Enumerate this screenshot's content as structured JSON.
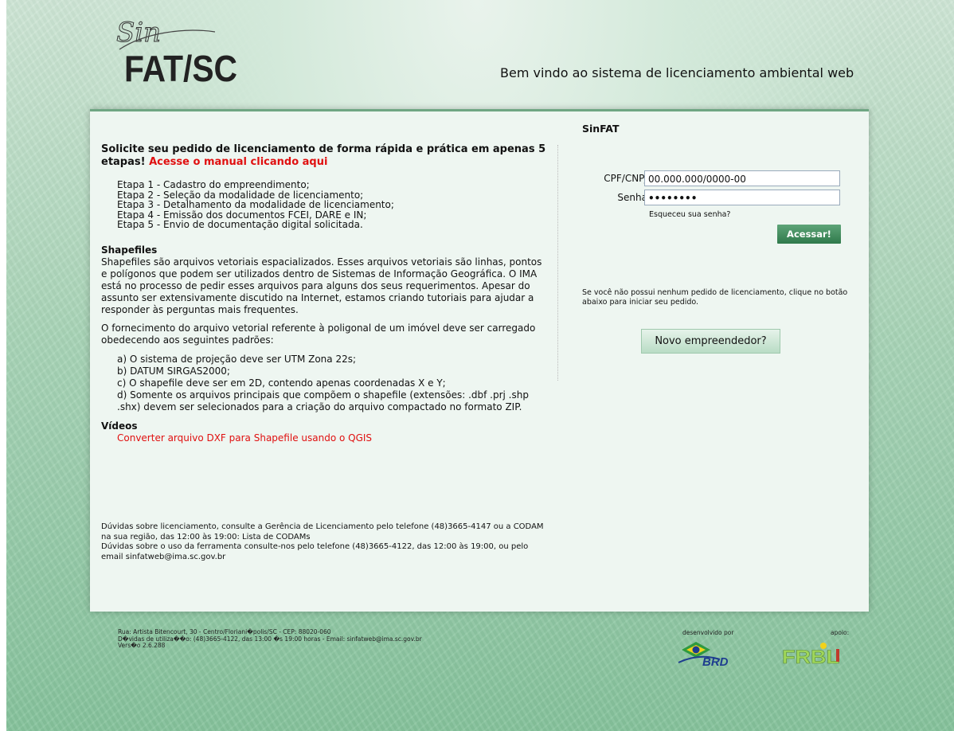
{
  "header": {
    "logo_script_text": "Sin",
    "logo_text": "FAT/SC",
    "welcome": "Bem vindo ao sistema de licenciamento ambiental web"
  },
  "intro": {
    "text": "Solicite seu pedido de licenciamento de forma rápida e prática em apenas 5 etapas!",
    "manual_link": "Acesse o manual clicando aqui"
  },
  "steps": [
    "Etapa 1 - Cadastro do empreendimento;",
    "Etapa 2 - Seleção da modalidade de licenciamento;",
    "Etapa 3 - Detalhamento da modalidade de licenciamento;",
    "Etapa 4 - Emissão dos documentos FCEI, DARE e IN;",
    "Etapa 5 - Envio de documentação digital solicitada."
  ],
  "shapefiles": {
    "heading": "Shapefiles",
    "para1": "Shapefiles são arquivos vetoriais espacializados. Esses arquivos vetoriais são linhas, pontos e polígonos que podem ser utilizados dentro de Sistemas de Informação Geográfica. O IMA está no processo de pedir esses arquivos para alguns dos seus requerimentos. Apesar do assunto ser extensivamente discutido na Internet, estamos criando tutoriais para ajudar a responder às perguntas mais frequentes.",
    "para2": "O fornecimento do arquivo vetorial referente à poligonal de um imóvel deve ser carregado obedecendo aos seguintes padrões:",
    "rules": [
      "a) O sistema de projeção deve ser UTM Zona 22s;",
      "b) DATUM SIRGAS2000;",
      "c) O shapefile deve ser em 2D, contendo apenas coordenadas X e Y;",
      "d) Somente os arquivos principais que compõem o shapefile (extensões: .dbf .prj .shp .shx) devem ser selecionados para a criação do arquivo compactado no formato ZIP."
    ]
  },
  "videos": {
    "heading": "Vídeos",
    "link": "Converter arquivo DXF para Shapefile usando o QGIS"
  },
  "contact": {
    "line1": "Dúvidas sobre licenciamento, consulte a Gerência de Licenciamento pelo telefone (48)3665-4147 ou a CODAM na sua região, das 12:00 às 19:00: Lista de CODAMs",
    "line2": "Dúvidas sobre o uso da ferramenta consulte-nos pelo telefone (48)3665-4122, das 12:00 às 19:00, ou pelo email sinfatweb@ima.sc.gov.br"
  },
  "login": {
    "title": "SinFAT",
    "cpf_label": "CPF/CNPJ:",
    "cpf_value": "00.000.000/0000-00",
    "password_label": "Senha:",
    "password_value": "••••••••",
    "forgot": "Esqueceu sua senha?",
    "submit": "Acessar!",
    "new_message": "Se você não possui nenhum pedido de licenciamento, clique no botão abaixo para iniciar seu pedido.",
    "new_button": "Novo empreendedor?"
  },
  "footer": {
    "address": "Rua: Artista Bitencourt, 30 - Centro/Floriani�polis/SC - CEP: 88020-060",
    "doubts": "D�vidas de utiliza��o: (48)3665-4122, das 13:00 �s 19:00 horas - Email: sinfatweb@ima.sc.gov.br",
    "version": "Vers�o 2.6.288",
    "developed_by": "desenvolvido por",
    "support": "apoio:",
    "brd_logo_text": "BRD",
    "frbl_logo_text": "FRBL"
  },
  "colors": {
    "panel_bg": "#eef6f1",
    "link_red": "#e01010",
    "button_green": "#2f7a4b"
  }
}
